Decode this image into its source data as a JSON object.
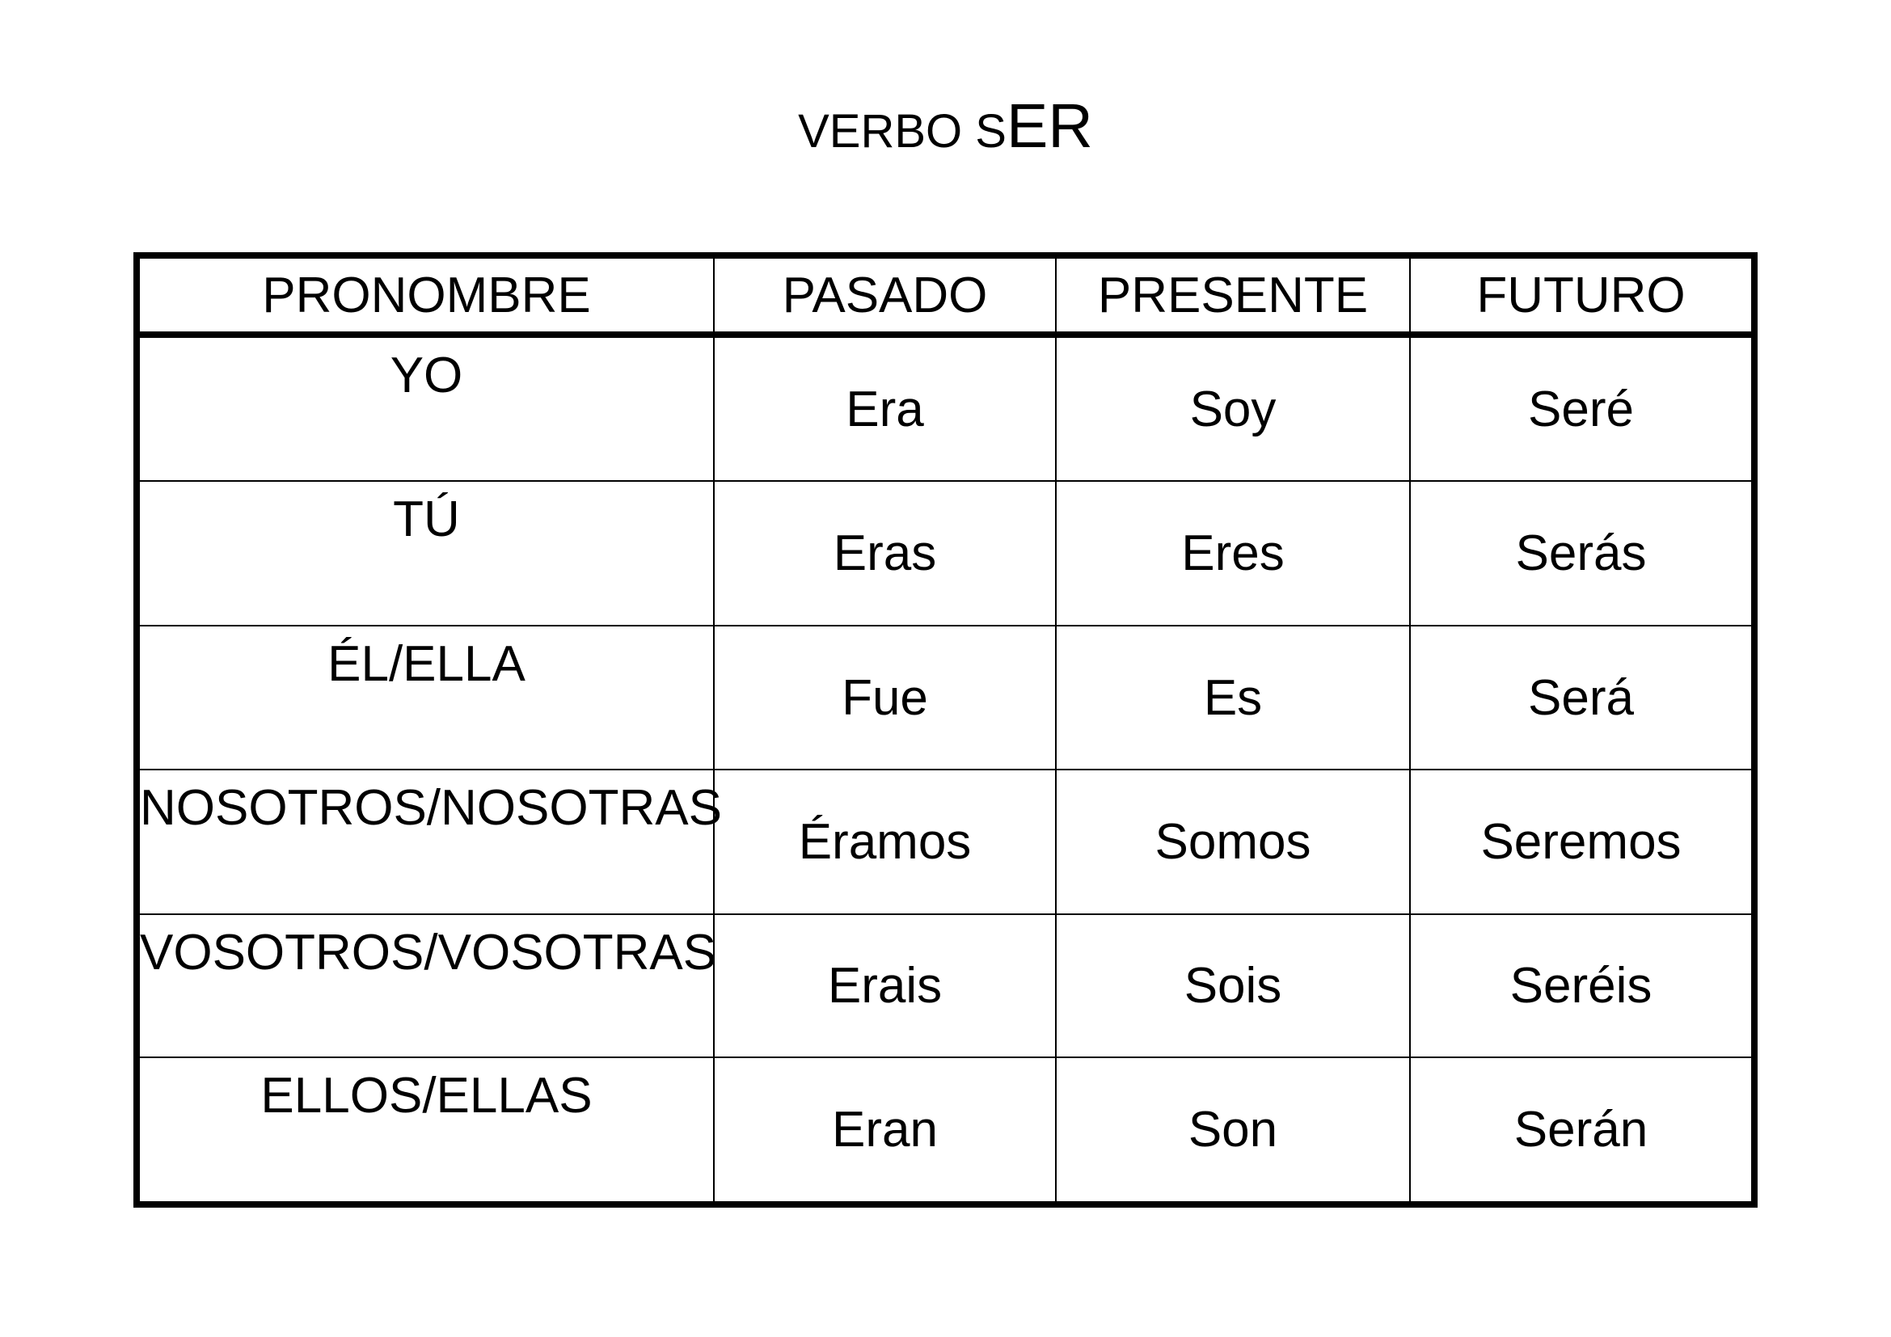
{
  "title": {
    "prefix": "VERBO S",
    "suffix": "ER"
  },
  "table": {
    "headers": [
      "PRONOMBRE",
      "PASADO",
      "PRESENTE",
      "FUTURO"
    ],
    "rows": [
      {
        "pronoun": "YO",
        "pasado": "Era",
        "presente": "Soy",
        "futuro": "Seré"
      },
      {
        "pronoun": "TÚ",
        "pasado": "Eras",
        "presente": "Eres",
        "futuro": "Serás"
      },
      {
        "pronoun": "ÉL/ELLA",
        "pasado": "Fue",
        "presente": "Es",
        "futuro": "Será"
      },
      {
        "pronoun": "NOSOTROS/NOSOTRAS",
        "pasado": "Éramos",
        "presente": "Somos",
        "futuro": "Seremos"
      },
      {
        "pronoun": "VOSOTROS/VOSOTRAS",
        "pasado": "Erais",
        "presente": "Sois",
        "futuro": "Seréis"
      },
      {
        "pronoun": "ELLOS/ELLAS",
        "pasado": "Eran",
        "presente": "Son",
        "futuro": "Serán"
      }
    ]
  }
}
